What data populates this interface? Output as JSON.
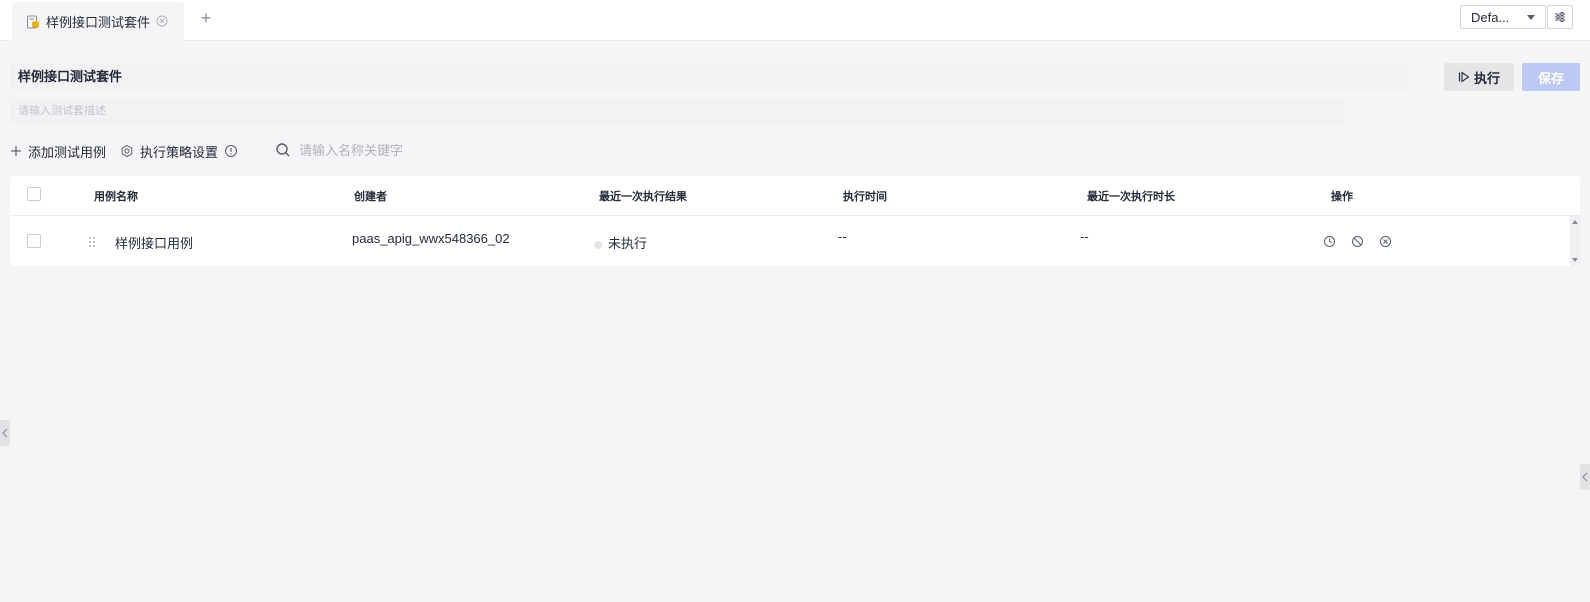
{
  "tabs": {
    "items": [
      {
        "label": "样例接口测试套件"
      }
    ],
    "add_label": "+"
  },
  "env": {
    "selected": "Defa..."
  },
  "suite": {
    "title": "样例接口测试套件",
    "description_placeholder": "请输入测试套描述",
    "run_label": "执行",
    "save_label": "保存"
  },
  "toolbar": {
    "add_case_label": "添加测试用例",
    "strategy_label": "执行策略设置",
    "search_placeholder": "请输入名称关键字"
  },
  "table": {
    "columns": [
      "用例名称",
      "创建者",
      "最近一次执行结果",
      "执行时间",
      "最近一次执行时长",
      "操作"
    ],
    "rows": [
      {
        "name": "样例接口用例",
        "creator": "paas_apig_wwx548366_02",
        "result": "未执行",
        "exec_time": "--",
        "duration": "--"
      }
    ]
  },
  "colors": {
    "primary_disabled": "#bcc9f5",
    "background": "#f5f5f7",
    "status_not_run": "#e3e4e8"
  },
  "icons": {
    "tab": "file-api-icon",
    "close": "close-circle-icon",
    "settings": "sliders-icon",
    "run": "play-outline-icon",
    "add": "plus-icon",
    "strategy": "gear-icon",
    "info": "info-circle-icon",
    "search": "search-icon",
    "drag": "drag-handle-icon",
    "op_history": "clock-icon",
    "op_disable": "ban-icon",
    "op_delete": "close-circle-icon"
  }
}
